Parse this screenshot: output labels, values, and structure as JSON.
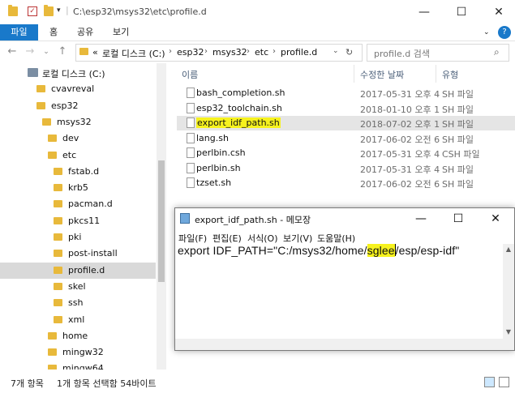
{
  "window": {
    "title": "C:\\esp32\\msys32\\etc\\profile.d",
    "minimize": "—",
    "maximize": "☐",
    "close": "✕"
  },
  "ribbon": {
    "tabs": [
      "파일",
      "홈",
      "공유",
      "보기"
    ],
    "expand_icon": "chevron-down-icon",
    "help_icon": "?"
  },
  "address": {
    "prefix": "«",
    "crumbs": [
      "로컬 디스크 (C:)",
      "esp32",
      "msys32",
      "etc",
      "profile.d"
    ],
    "search_placeholder": "profile.d 검색"
  },
  "nav_tree": [
    {
      "label": "로컬 디스크 (C:)",
      "indent": 0,
      "icon": "drive-icon"
    },
    {
      "label": "cvavreval",
      "indent": 1
    },
    {
      "label": "esp32",
      "indent": 1
    },
    {
      "label": "msys32",
      "indent": 2
    },
    {
      "label": "dev",
      "indent": 3
    },
    {
      "label": "etc",
      "indent": 3
    },
    {
      "label": "fstab.d",
      "indent": 4
    },
    {
      "label": "krb5",
      "indent": 4
    },
    {
      "label": "pacman.d",
      "indent": 4
    },
    {
      "label": "pkcs11",
      "indent": 4
    },
    {
      "label": "pki",
      "indent": 4
    },
    {
      "label": "post-install",
      "indent": 4
    },
    {
      "label": "profile.d",
      "indent": 4,
      "selected": true
    },
    {
      "label": "skel",
      "indent": 4
    },
    {
      "label": "ssh",
      "indent": 4
    },
    {
      "label": "xml",
      "indent": 4
    },
    {
      "label": "home",
      "indent": 3
    },
    {
      "label": "mingw32",
      "indent": 3
    },
    {
      "label": "mingw64",
      "indent": 3
    }
  ],
  "columns": {
    "name": "이름",
    "date": "수정한 날짜",
    "type": "유형"
  },
  "files": [
    {
      "name": "bash_completion.sh",
      "date": "2017-05-31 오후 4",
      "type": "SH 파일"
    },
    {
      "name": "esp32_toolchain.sh",
      "date": "2018-01-10 오후 1",
      "type": "SH 파일"
    },
    {
      "name": "export_idf_path.sh",
      "date": "2018-07-02 오후 1",
      "type": "SH 파일",
      "selected": true
    },
    {
      "name": "lang.sh",
      "date": "2017-06-02 오전 6",
      "type": "SH 파일"
    },
    {
      "name": "perlbin.csh",
      "date": "2017-05-31 오후 4",
      "type": "CSH 파일"
    },
    {
      "name": "perlbin.sh",
      "date": "2017-05-31 오후 4",
      "type": "SH 파일"
    },
    {
      "name": "tzset.sh",
      "date": "2017-06-02 오전 6",
      "type": "SH 파일"
    }
  ],
  "status": {
    "count": "7개 항목",
    "selection": "1개 항목 선택함 54바이트"
  },
  "notepad": {
    "title": "export_idf_path.sh - 메모장",
    "menu": [
      "파일(F)",
      "편집(E)",
      "서식(O)",
      "보기(V)",
      "도움말(H)"
    ],
    "content_before": "export IDF_PATH=\"C:/msys32/home/",
    "content_highlight": "sglee",
    "content_after": "/esp/esp-idf\""
  }
}
